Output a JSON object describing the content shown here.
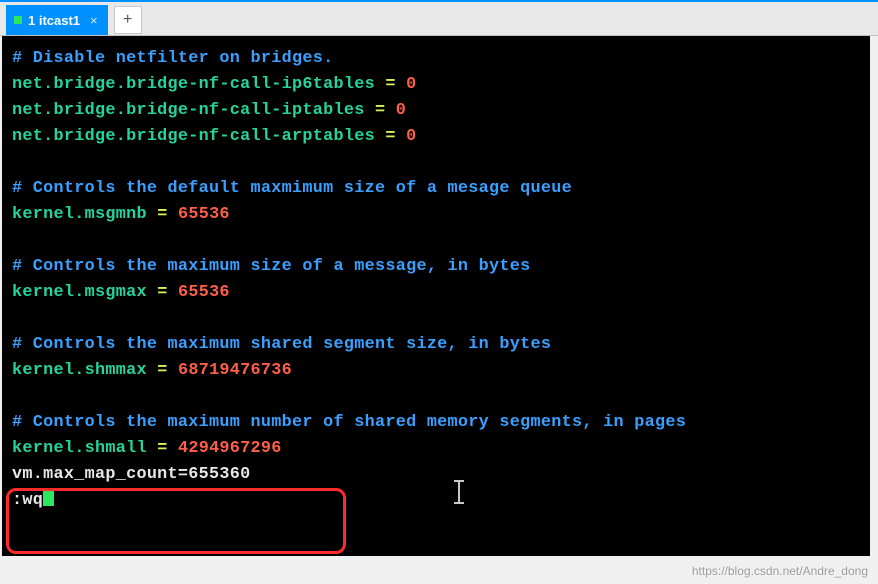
{
  "tabs": {
    "active": {
      "label": "1 itcast1",
      "close": "×"
    },
    "add": "+"
  },
  "terminal": {
    "lines": [
      {
        "type": "comment",
        "text": "# Disable netfilter on bridges."
      },
      {
        "type": "kv",
        "key": "net.bridge.bridge-nf-call-ip6tables",
        "eq": " = ",
        "val": "0"
      },
      {
        "type": "kv",
        "key": "net.bridge.bridge-nf-call-iptables",
        "eq": " = ",
        "val": "0"
      },
      {
        "type": "kv",
        "key": "net.bridge.bridge-nf-call-arptables",
        "eq": " = ",
        "val": "0"
      },
      {
        "type": "blank"
      },
      {
        "type": "comment",
        "text": "# Controls the default maxmimum size of a mesage queue"
      },
      {
        "type": "kv",
        "key": "kernel.msgmnb",
        "eq": " = ",
        "val": "65536"
      },
      {
        "type": "blank"
      },
      {
        "type": "comment",
        "text": "# Controls the maximum size of a message, in bytes"
      },
      {
        "type": "kv",
        "key": "kernel.msgmax",
        "eq": " = ",
        "val": "65536"
      },
      {
        "type": "blank"
      },
      {
        "type": "comment",
        "text": "# Controls the maximum shared segment size, in bytes"
      },
      {
        "type": "kv",
        "key": "kernel.shmmax",
        "eq": " = ",
        "val": "68719476736"
      },
      {
        "type": "blank"
      },
      {
        "type": "comment",
        "text": "# Controls the maximum number of shared memory segments, in pages"
      },
      {
        "type": "kv",
        "key": "kernel.shmall",
        "eq": " = ",
        "val": "4294967296"
      },
      {
        "type": "plain",
        "text": "vm.max_map_count=655360"
      },
      {
        "type": "cmd",
        "text": ":wq"
      }
    ]
  },
  "watermark": "https://blog.csdn.net/Andre_dong"
}
